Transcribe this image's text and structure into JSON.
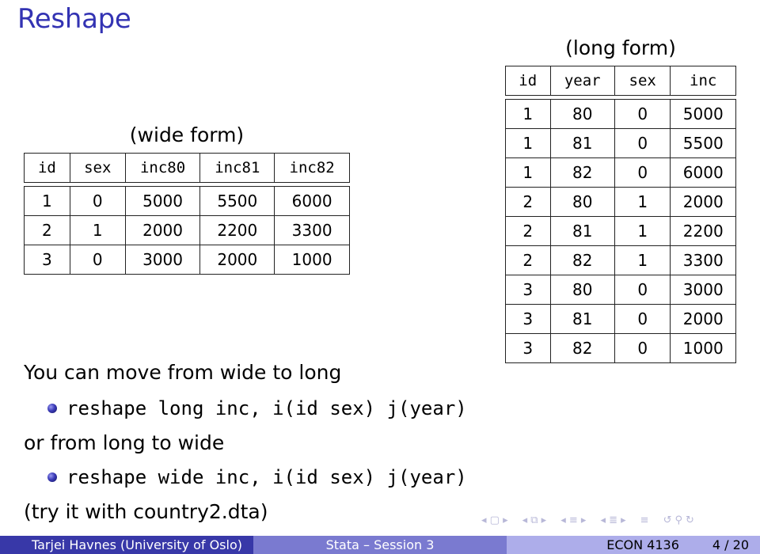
{
  "slide": {
    "title": "Reshape"
  },
  "wide_table": {
    "caption": "(wide form)",
    "headers": [
      "id",
      "sex",
      "inc80",
      "inc81",
      "inc82"
    ],
    "rows": [
      [
        "1",
        "0",
        "5000",
        "5500",
        "6000"
      ],
      [
        "2",
        "1",
        "2000",
        "2200",
        "3300"
      ],
      [
        "3",
        "0",
        "3000",
        "2000",
        "1000"
      ]
    ]
  },
  "long_table": {
    "caption": "(long form)",
    "headers": [
      "id",
      "year",
      "sex",
      "inc"
    ],
    "rows": [
      [
        "1",
        "80",
        "0",
        "5000"
      ],
      [
        "1",
        "81",
        "0",
        "5500"
      ],
      [
        "1",
        "82",
        "0",
        "6000"
      ],
      [
        "2",
        "80",
        "1",
        "2000"
      ],
      [
        "2",
        "81",
        "1",
        "2200"
      ],
      [
        "2",
        "82",
        "1",
        "3300"
      ],
      [
        "3",
        "80",
        "0",
        "3000"
      ],
      [
        "3",
        "81",
        "0",
        "2000"
      ],
      [
        "3",
        "82",
        "0",
        "1000"
      ]
    ]
  },
  "body": {
    "line1": "You can move from wide to long",
    "cmd1": "reshape long inc, i(id sex) j(year)",
    "line2": "or from long to wide",
    "cmd2": "reshape wide inc, i(id sex) j(year)",
    "line3": "(try it with country2.dta)"
  },
  "nav_icons": [
    "frame-prev-icon",
    "frame-icon",
    "frame-next-icon",
    "subsection-prev-icon",
    "subsection-icon",
    "subsection-next-icon",
    "section-prev-icon",
    "section-icon",
    "section-next-icon",
    "align-icon",
    "undo-icon",
    "search-icon",
    "redo-icon"
  ],
  "footer": {
    "author": "Tarjei Havnes  (University of Oslo)",
    "session": "Stata – Session 3",
    "course": "ECON 4136",
    "page": "4 / 20"
  },
  "colors": {
    "title": "#3333b3",
    "footer_left": "#3838a8",
    "footer_mid": "#7a7ad0",
    "footer_right": "#adadea"
  }
}
